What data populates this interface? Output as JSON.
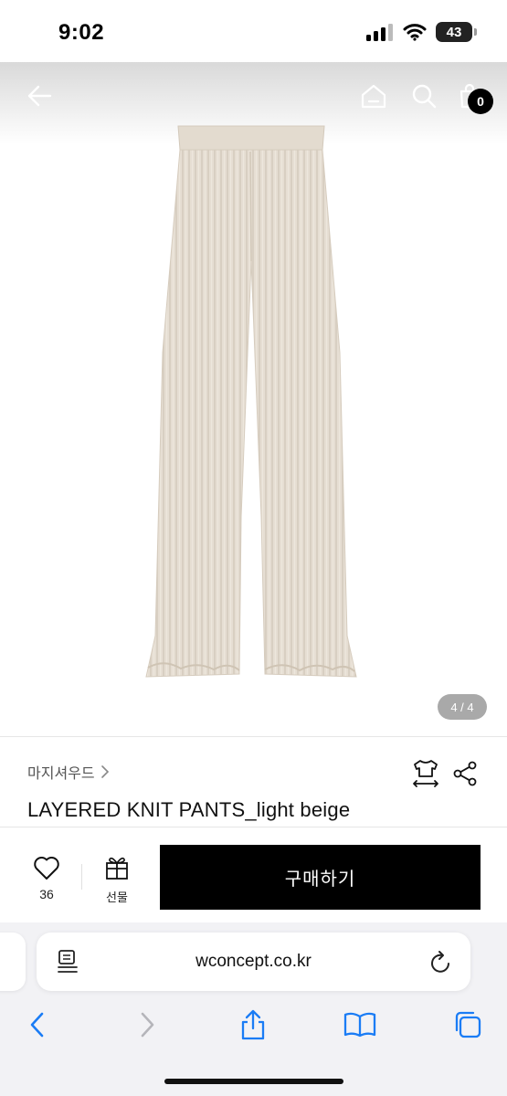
{
  "status_bar": {
    "time": "9:02",
    "battery": "43"
  },
  "header": {
    "back_icon": "arrow-left-icon",
    "home_icon": "home-icon",
    "search_icon": "search-icon",
    "cart_icon": "shopping-bag-icon",
    "cart_count": "0"
  },
  "gallery": {
    "page_indicator": "4 / 4"
  },
  "product": {
    "brand": "마지셔우드",
    "title": "LAYERED KNIT PANTS_light beige"
  },
  "actions": {
    "like_count": "36",
    "gift_label": "선물",
    "buy_label": "구매하기"
  },
  "browser": {
    "url": "wconcept.co.kr"
  },
  "colors": {
    "product_beige": "#e6ded3",
    "buy_button": "#000000",
    "browser_bg": "#f2f2f5",
    "ios_blue": "#1a7cf5"
  }
}
